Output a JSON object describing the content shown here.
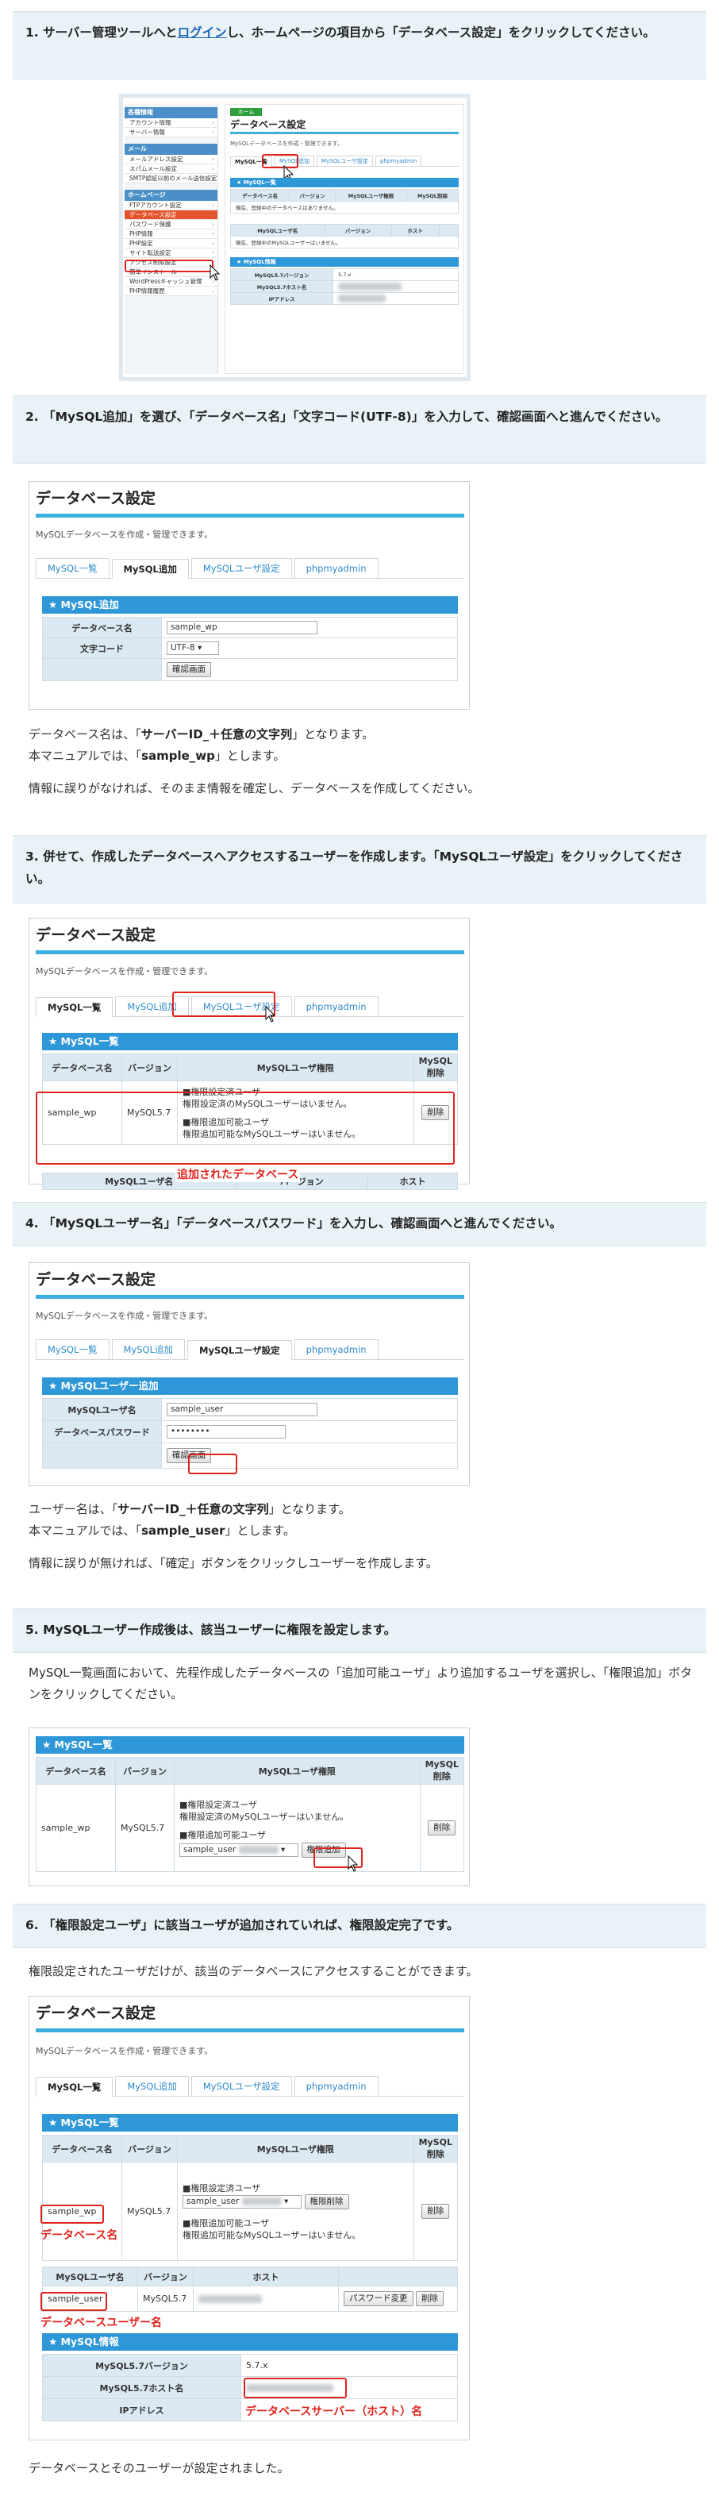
{
  "steps": [
    {
      "pre": "1. サーバー管理ツールへと",
      "link": "ログイン",
      "post": "し、ホームページの項目から「データベース設定」をクリックしてください。"
    },
    {
      "text": "2. 「MySQL追加」を選び、「データベース名」「文字コード(UTF-8)」を入力して、確認画面へと進んでください。"
    },
    {
      "text": "3. 併せて、作成したデータベースへアクセスするユーザーを作成します。「MySQLユーザ設定」をクリックしてください。"
    },
    {
      "text": "4. 「MySQLユーザー名」「データベースパスワード」を入力し、確認画面へと進んでください。"
    },
    {
      "text": "5. MySQLユーザー作成後は、該当ユーザーに権限を設定します。"
    },
    {
      "text": "6. 「権限設定ユーザ」に該当ユーザが追加されていれば、権限設定完了です。"
    }
  ],
  "para2": {
    "l1a": "データベース名は、「",
    "l1b": "サーバーID_＋任意の文字列",
    "l1c": "」となります。",
    "l2a": "本マニュアルでは、「",
    "l2b": "sample_wp",
    "l2c": "」とします。",
    "l3": "情報に誤りがなければ、そのまま情報を確定し、データベースを作成してください。"
  },
  "para4": {
    "l1a": "ユーザー名は、「",
    "l1b": "サーバーID_＋任意の文字列",
    "l1c": "」となります。",
    "l2a": "本マニュアルでは、「",
    "l2b": "sample_user",
    "l2c": "」とします。",
    "l3": "情報に誤りが無ければ、「確定」ボタンをクリックしユーザーを作成します。"
  },
  "para5": "MySQL一覧画面において、先程作成したデータベースの「追加可能ユーザ」より追加するユーザを選択し、「権限追加」ボタンをクリックしてください。",
  "para6": "権限設定されたユーザだけが、該当のデータベースにアクセスすることができます。",
  "final": "データベースとそのユーザーが設定されました。",
  "panel": {
    "title": "データベース設定",
    "desc": "MySQLデータベースを作成・管理できます。",
    "tabs": [
      "MySQL一覧",
      "MySQL追加",
      "MySQLユーザ設定",
      "phpmyadmin"
    ],
    "box_list": "★ MySQL一覧",
    "box_add": "★ MySQL追加",
    "box_useradd": "★ MySQLユーザー追加",
    "box_info": "★ MySQL情報",
    "col_db": "データベース名",
    "col_ver": "バージョン",
    "col_perm": "MySQLユーザ権限",
    "col_del": "MySQL削除",
    "col_user": "MySQLユーザ名",
    "col_host": "ホスト",
    "lbl_dbname": "データベース名",
    "lbl_charset": "文字コード",
    "val_dbname": "sample_wp",
    "val_charset": "UTF-8",
    "btn_confirm": "確認画面",
    "lbl_user": "MySQLユーザ名",
    "lbl_pass": "データベースパスワード",
    "val_user": "sample_user",
    "val_pass": "••••••••",
    "db": "sample_wp",
    "ver": "MySQL5.7",
    "user": "sample_user",
    "perm_set": "■権限設定済ユーザ",
    "perm_none": "権限設定済のMySQLユーザーはいません。",
    "perm_add": "■権限追加可能ユーザ",
    "perm_add_none": "権限追加可能なMySQLユーザーはいません。",
    "btn_delete": "削除",
    "btn_addperm": "権限追加",
    "btn_removeperm": "権限削除",
    "btn_pwchange": "パスワード変更",
    "info_ver": "MySQL5.7バージョン",
    "info_host": "MySQL5.7ホスト名",
    "info_ip": "IPアドレス",
    "val_ver": "5.7.x",
    "ann_added": "追加されたデータベース",
    "ann_dbname": "データベース名",
    "ann_dbuser": "データベースユーザー名",
    "ann_host": "データベースサーバー（ホスト）名",
    "step1_none": "現在、登録中のデータベースはありません。",
    "step1_user_none": "現在、登録中のMySQLユーザーはいません。"
  },
  "sidebar": {
    "cats": [
      {
        "label": "各種情報",
        "color": "#4a8fc7"
      },
      {
        "label": "メール",
        "color": "#4a8fc7"
      },
      {
        "label": "ホームページ",
        "color": "#4a8fc7"
      }
    ],
    "items1": [
      "アカウント情報",
      "サーバー情報"
    ],
    "items2": [
      "メールアドレス設定",
      "スパムメール設定",
      "SMTP認証以前のメール送信設定"
    ],
    "items3": [
      "FTPアカウント設定",
      "データベース設定",
      "パスワード保護",
      "PHP情報",
      "PHP設定",
      "サイト転送設定",
      "アクセス制限設定",
      "簡単インストール",
      "WordPressキャッシュ管理",
      "PHP情報履歴"
    ],
    "top_button": "ホーム"
  }
}
